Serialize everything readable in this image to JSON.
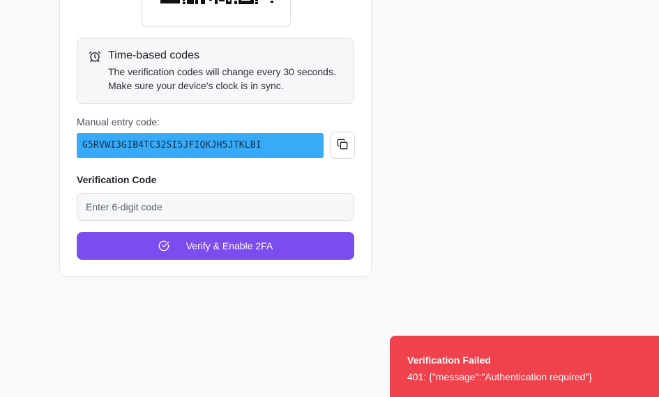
{
  "info": {
    "title": "Time-based codes",
    "text": "The verification codes will change every 30 seconds. Make sure your device's clock is in sync."
  },
  "manual": {
    "label": "Manual entry code:",
    "code": "G5RVWI3GIB4TC32SI5JFIQKJH5JTKLBI"
  },
  "verification": {
    "label": "Verification Code",
    "placeholder": "Enter 6-digit code",
    "value": ""
  },
  "button": {
    "label": "Verify & Enable 2FA"
  },
  "toast": {
    "title": "Verification Failed",
    "message": "401: {\"message\":\"Authentication required\"}"
  },
  "icons": {
    "info": "alarm-clock-icon",
    "copy": "copy-icon",
    "verify": "check-circle-icon"
  },
  "colors": {
    "accent": "#7c4dee",
    "code_highlight": "#38aaf8",
    "error": "#f0424d"
  }
}
